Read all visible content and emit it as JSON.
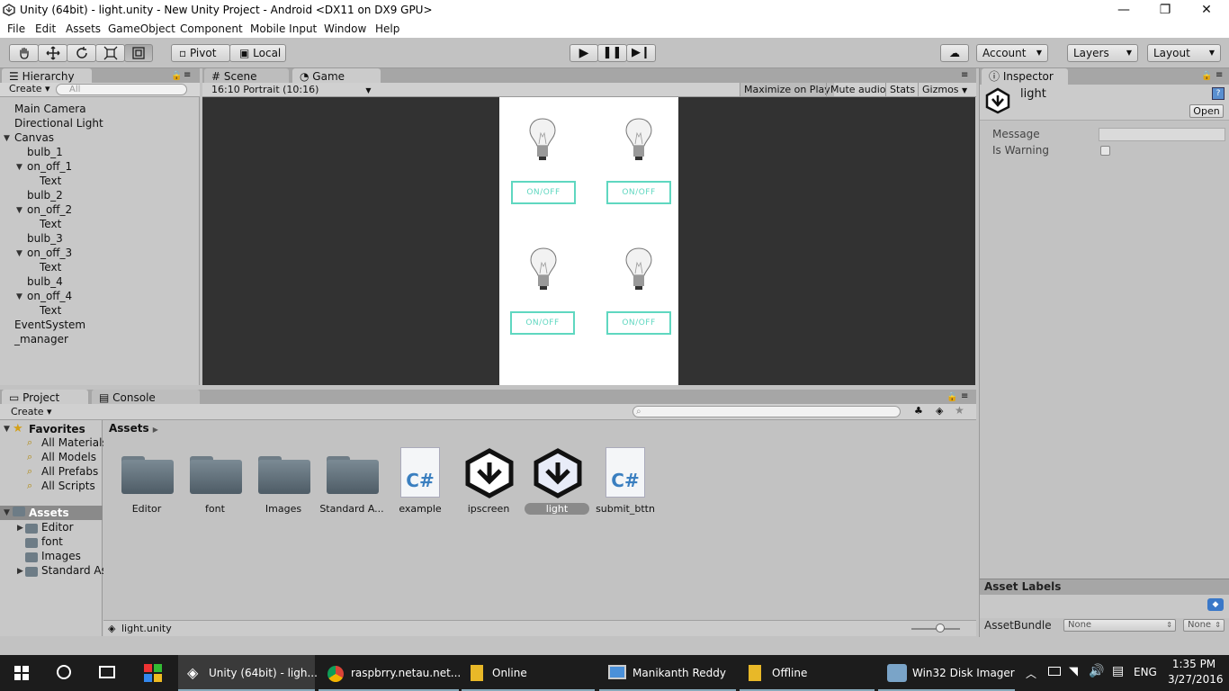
{
  "window": {
    "title": "Unity (64bit) - light.unity - New Unity Project - Android <DX11 on DX9 GPU>",
    "minimize": "—",
    "maximize": "❐",
    "close": "✕"
  },
  "menu": [
    "File",
    "Edit",
    "Assets",
    "GameObject",
    "Component",
    "Mobile Input",
    "Window",
    "Help"
  ],
  "toolbar": {
    "pivot": "Pivot",
    "local": "Local",
    "account": "Account",
    "layers": "Layers",
    "layout": "Layout"
  },
  "hierarchy": {
    "tab": "Hierarchy",
    "create": "Create",
    "search_placeholder": "All",
    "items": [
      {
        "label": "Main Camera",
        "indent": 0,
        "expand": false
      },
      {
        "label": "Directional Light",
        "indent": 0,
        "expand": false
      },
      {
        "label": "Canvas",
        "indent": 0,
        "expand": true
      },
      {
        "label": "bulb_1",
        "indent": 1,
        "expand": false
      },
      {
        "label": "on_off_1",
        "indent": 1,
        "expand": true
      },
      {
        "label": "Text",
        "indent": 2,
        "expand": false
      },
      {
        "label": "bulb_2",
        "indent": 1,
        "expand": false
      },
      {
        "label": "on_off_2",
        "indent": 1,
        "expand": true
      },
      {
        "label": "Text",
        "indent": 2,
        "expand": false
      },
      {
        "label": "bulb_3",
        "indent": 1,
        "expand": false
      },
      {
        "label": "on_off_3",
        "indent": 1,
        "expand": true
      },
      {
        "label": "Text",
        "indent": 2,
        "expand": false
      },
      {
        "label": "bulb_4",
        "indent": 1,
        "expand": false
      },
      {
        "label": "on_off_4",
        "indent": 1,
        "expand": true
      },
      {
        "label": "Text",
        "indent": 2,
        "expand": false
      },
      {
        "label": "EventSystem",
        "indent": 0,
        "expand": false
      },
      {
        "label": "_manager",
        "indent": 0,
        "expand": false
      }
    ]
  },
  "game": {
    "scene_tab": "Scene",
    "game_tab": "Game",
    "aspect": "16:10 Portrait (10:16)",
    "maximize_on_play": "Maximize on Play",
    "mute_audio": "Mute audio",
    "stats": "Stats",
    "gizmos": "Gizmos",
    "button_label": "ON/OFF"
  },
  "inspector": {
    "tab": "Inspector",
    "object_name": "light",
    "open": "Open",
    "fields": [
      {
        "label": "Message"
      },
      {
        "label": "Is Warning"
      }
    ],
    "asset_labels": "Asset Labels",
    "asset_bundle": "AssetBundle",
    "bundle_value": "None",
    "variant_value": "None"
  },
  "project": {
    "tab": "Project",
    "console_tab": "Console",
    "create": "Create",
    "favorites_title": "Favorites",
    "favorites": [
      "All Materials",
      "All Models",
      "All Prefabs",
      "All Scripts"
    ],
    "assets_title": "Assets",
    "assets_folders": [
      "Editor",
      "font",
      "Images",
      "Standard As"
    ],
    "breadcrumb": "Assets",
    "items": [
      {
        "label": "Editor",
        "kind": "folder"
      },
      {
        "label": "font",
        "kind": "folder"
      },
      {
        "label": "Images",
        "kind": "folder"
      },
      {
        "label": "Standard A...",
        "kind": "folder"
      },
      {
        "label": "example",
        "kind": "script"
      },
      {
        "label": "ipscreen",
        "kind": "scene"
      },
      {
        "label": "light",
        "kind": "scene",
        "selected": true
      },
      {
        "label": "submit_bttn",
        "kind": "script"
      }
    ],
    "status_file": "light.unity"
  },
  "taskbar": {
    "items": [
      "Unity (64bit) - ligh...",
      "raspbrry.netau.net...",
      "Online",
      "Manikanth Reddy",
      "Offline",
      "Win32 Disk Imager"
    ],
    "lang": "ENG",
    "time": "1:35 PM",
    "date": "3/27/2016"
  },
  "colors": {
    "button_teal": "#5fd7c0",
    "game_bg": "#323232",
    "editor_bg": "#c2c2c2"
  }
}
